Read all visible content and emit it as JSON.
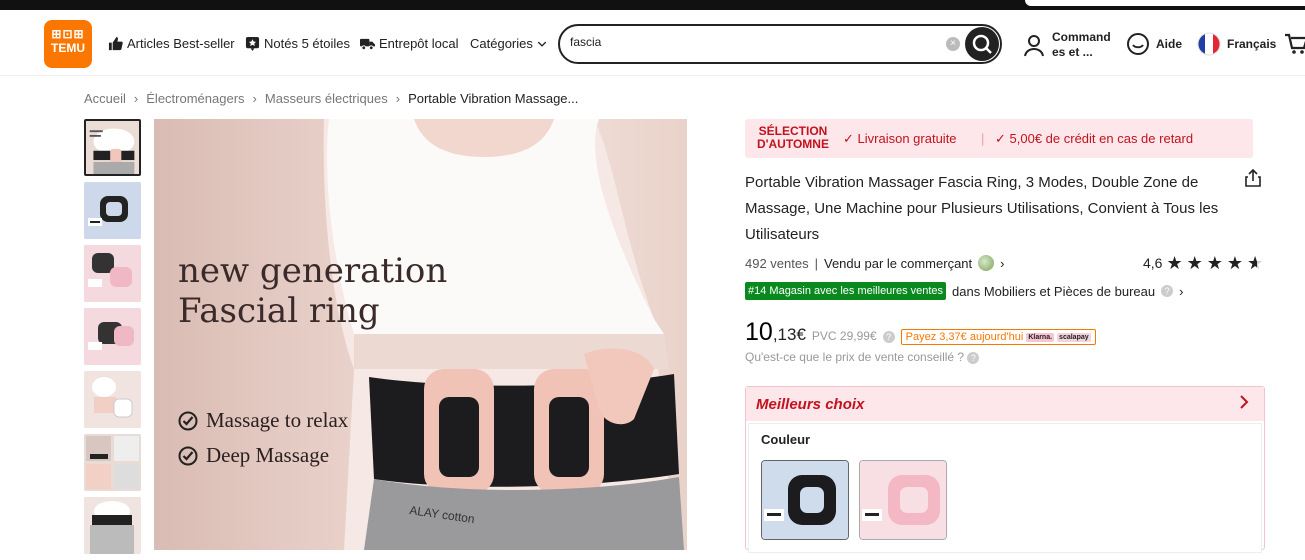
{
  "header": {
    "logo_top": "⊞⊡⊞",
    "logo_text": "TEMU",
    "nav": [
      {
        "label": "Articles Best-seller",
        "icon": "thumbs-up-icon"
      },
      {
        "label": "Notés 5 étoiles",
        "icon": "star-badge-icon"
      },
      {
        "label": "Entrepôt local",
        "icon": "truck-icon"
      },
      {
        "label": "Catégories",
        "icon": "chevron-down-icon"
      }
    ],
    "search": {
      "value": "fascia",
      "placeholder": ""
    },
    "orders": "Command es et ...",
    "help": "Aide",
    "language": "Français"
  },
  "breadcrumb": [
    "Accueil",
    "Électroménagers",
    "Masseurs électriques",
    "Portable Vibration Massage..."
  ],
  "hero": {
    "line1": "new generation",
    "line2": "Fascial ring",
    "bullet1": "Massage to relax",
    "bullet2": "Deep Massage",
    "waistband": "ALAY cotton"
  },
  "promo": {
    "tag_line1": "SÉLECTION",
    "tag_line2": "D'AUTOMNE",
    "item1": "Livraison gratuite",
    "item2": "5,00€ de crédit en cas de retard"
  },
  "product": {
    "title": "Portable Vibration Massager Fascia Ring, 3 Modes, Double Zone de Massage, Une Machine pour Plusieurs Utilisations, Convient à Tous les Utilisateurs",
    "sales": "492 ventes",
    "seller": "Vendu par le commerçant",
    "rating": "4,6",
    "rating_value": 4.6,
    "rank_badge": "#14 Magasin avec les meilleures ventes",
    "rank_category": "dans Mobiliers et Pièces de bureau",
    "price_int": "10",
    "price_dec": ",13€",
    "pvc": "PVC 29,99€",
    "pay_today": "Payez 3,37€ aujourd'hui",
    "klarna": "Klarna.",
    "scalapay": "scalapay",
    "pvc_question": "Qu'est-ce que le prix de vente conseillé ?"
  },
  "choice": {
    "title": "Meilleurs choix",
    "color_label": "Couleur"
  },
  "colors": {
    "accent": "#fb7701",
    "red": "#c1121f",
    "green": "#0a8a1e",
    "pink_bg": "#fde7ea"
  }
}
